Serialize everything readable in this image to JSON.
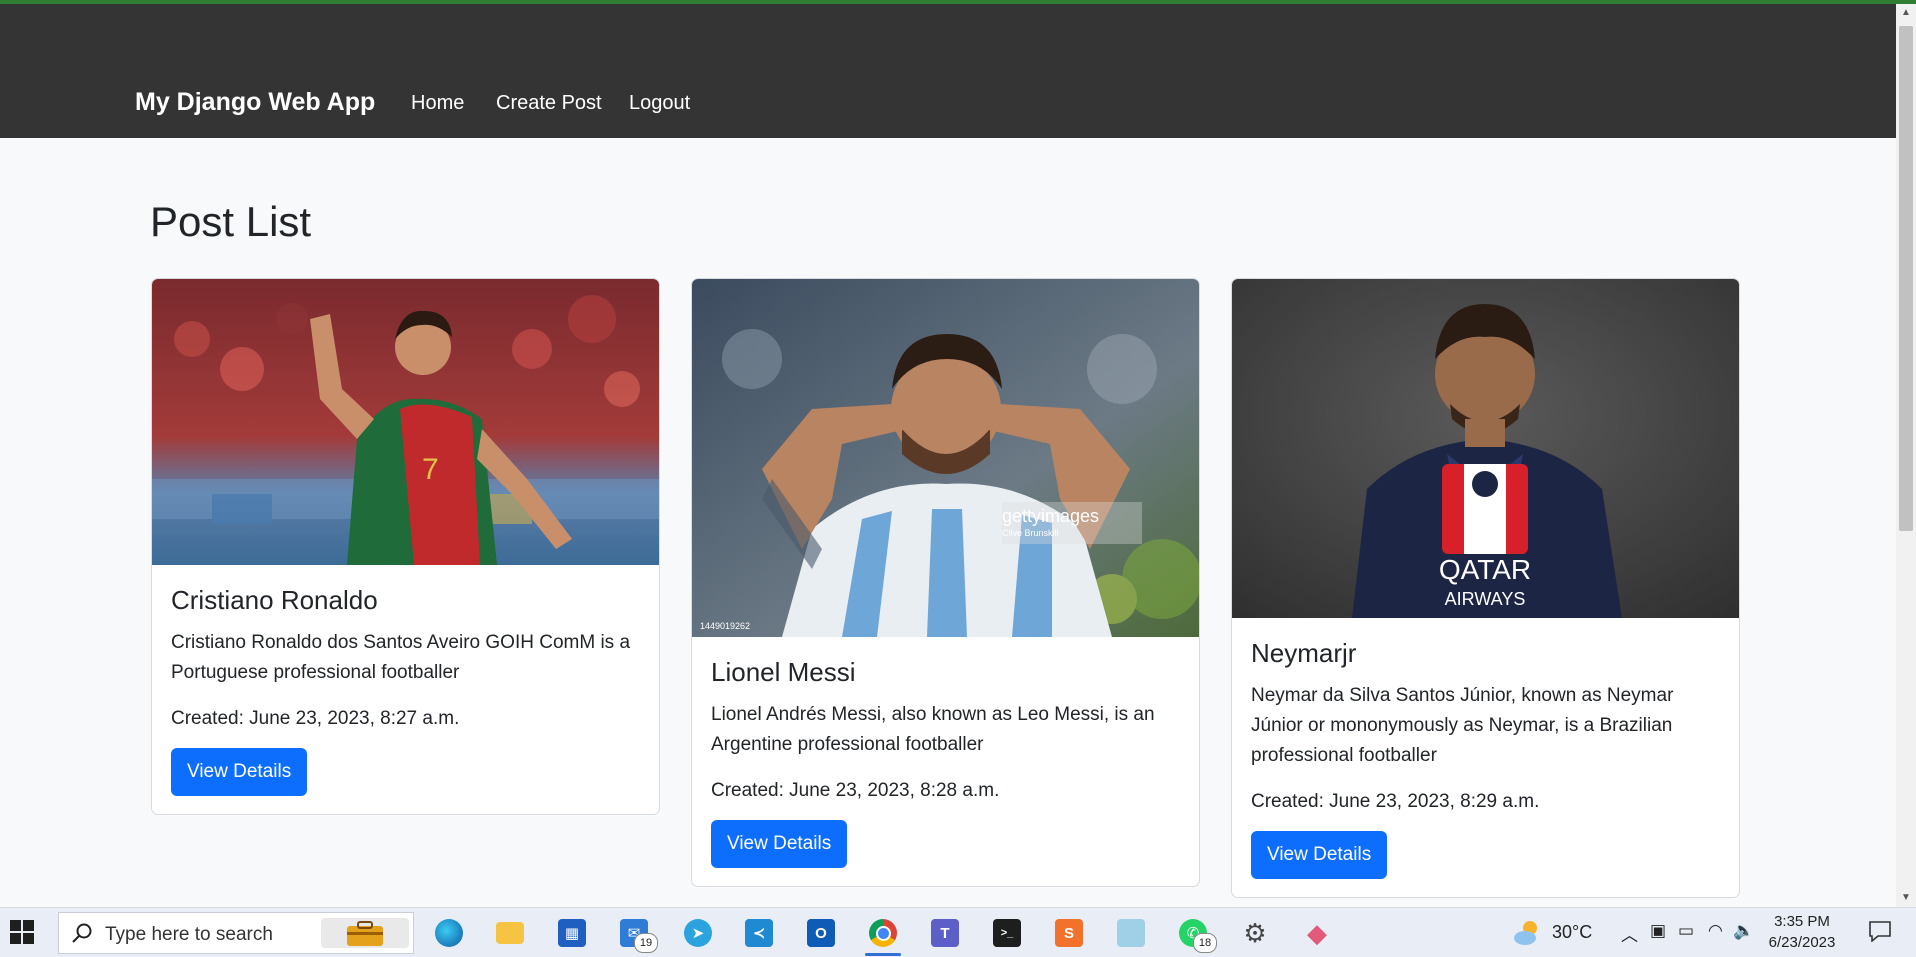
{
  "navbar": {
    "brand": "My Django Web App",
    "links": [
      {
        "label": "Home"
      },
      {
        "label": "Create Post"
      },
      {
        "label": "Logout"
      }
    ]
  },
  "page": {
    "title": "Post List"
  },
  "posts": [
    {
      "title": "Cristiano Ronaldo",
      "description": "Cristiano Ronaldo dos Santos Aveiro GOIH ComM is a Portuguese professional footballer",
      "created": "Created: June 23, 2023, 8:27 a.m.",
      "button_label": "View Details"
    },
    {
      "title": "Lionel Messi",
      "description": "Lionel Andrés Messi, also known as Leo Messi, is an Argentine professional footballer",
      "created": "Created: June 23, 2023, 8:28 a.m.",
      "button_label": "View Details",
      "watermark": "gettyimages",
      "watermark_credit": "Clive Brunskill",
      "image_id": "1449019262"
    },
    {
      "title": "Neymarjr",
      "description": "Neymar da Silva Santos Júnior, known as Neymar Júnior or mononymously as Neymar, is a Brazilian professional footballer",
      "created": "Created: June 23, 2023, 8:29 a.m.",
      "button_label": "View Details"
    }
  ],
  "taskbar": {
    "search_placeholder": "Type here to search",
    "apps": [
      {
        "icon": "edge-icon"
      },
      {
        "icon": "file-explorer-icon"
      },
      {
        "icon": "microsoft-store-icon"
      },
      {
        "icon": "mail-icon",
        "badge": "19"
      },
      {
        "icon": "telegram-icon"
      },
      {
        "icon": "vscode-icon"
      },
      {
        "icon": "outlook-icon"
      },
      {
        "icon": "chrome-icon"
      },
      {
        "icon": "teams-icon"
      },
      {
        "icon": "terminal-icon"
      },
      {
        "icon": "sublime-text-icon"
      },
      {
        "icon": "notepad-icon"
      },
      {
        "icon": "whatsapp-icon",
        "badge": "18"
      },
      {
        "icon": "settings-icon"
      },
      {
        "icon": "git-icon"
      }
    ],
    "weather": "30°C",
    "time": "3:35 PM",
    "date": "6/23/2023"
  },
  "colors": {
    "navbar_bg": "#343434",
    "primary_button": "#0d6efd",
    "page_bg": "#f8f9fa"
  }
}
